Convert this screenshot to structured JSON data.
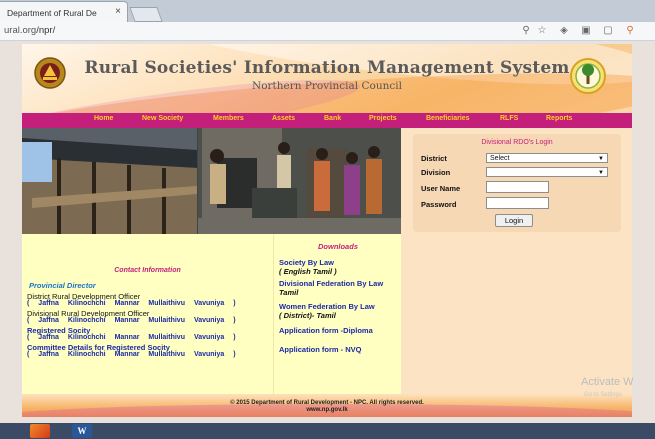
{
  "browser": {
    "tab_title": "Department of Rural De",
    "tab_close": "×",
    "url_host": "ural.org",
    "url_path": "/npr/"
  },
  "header": {
    "title": "Rural Societies' Information Management System",
    "subtitle": "Northern Provincial Council"
  },
  "nav": {
    "items": [
      "Home",
      "New Society",
      "Members",
      "Assets",
      "Bank",
      "Projects",
      "Beneficiaries",
      "RLFS",
      "Reports"
    ]
  },
  "login": {
    "title": "Divisional RDO's Login",
    "district_label": "District",
    "district_value": "Select",
    "division_label": "Division",
    "division_value": "",
    "username_label": "User Name",
    "password_label": "Password",
    "button": "Login"
  },
  "contact": {
    "title": "Contact Information",
    "provincial_director": "Provincial Director",
    "district_officer": "District Rural Development Officer",
    "divisional_officer": "Divisional Rural Development Officer",
    "registered_society": "Registered Socity",
    "committee_details": "Committee Details for Registered Socity",
    "open_paren": "(",
    "close_paren": ")",
    "districts": [
      "Jaffna",
      "Kilinochchi",
      "Mannar",
      "Mullaithivu",
      "Vavuniya"
    ]
  },
  "downloads": {
    "title": "Downloads",
    "items": [
      {
        "label": "Society By Law",
        "sub": "( English      Tamil )"
      },
      {
        "label": "Divisional Federation By Law",
        "sub": "Tamil"
      },
      {
        "label": "Women Federation By Law",
        "sub": "( District)- Tamil"
      },
      {
        "label": "Application form -Diploma",
        "sub": ""
      },
      {
        "label": "Application form - NVQ",
        "sub": ""
      }
    ]
  },
  "footer": {
    "line1": "© 2015 Department of Rural Development - NPC. All rights reserved.",
    "line2": "www.np.gov.lk"
  },
  "watermark": {
    "line1": "Activate W",
    "line2": "Go to Settings"
  },
  "taskbar": {
    "word_label": "W"
  },
  "colors": {
    "nav_bg": "#c41f7b",
    "nav_text": "#ffd21e",
    "link": "#1a2aa8",
    "accent": "#c41f7b",
    "panel": "#ffffc2"
  }
}
